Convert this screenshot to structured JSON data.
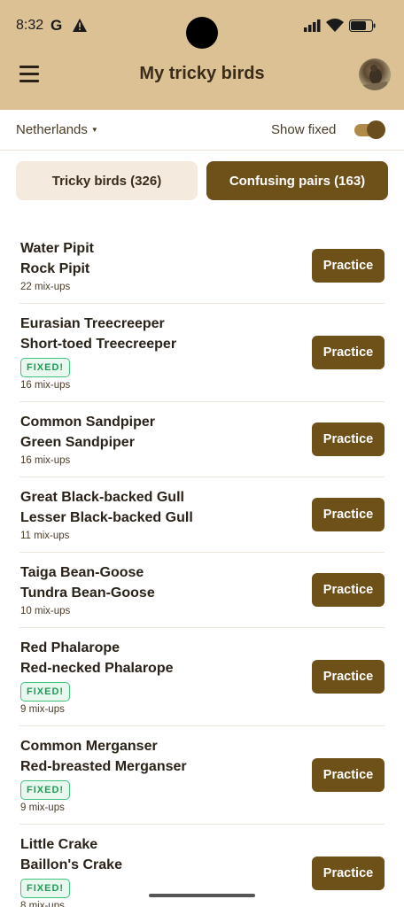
{
  "status_bar": {
    "time": "8:32",
    "g_label": "G"
  },
  "app_bar": {
    "title": "My tricky birds",
    "menu_icon": "hamburger-menu-icon",
    "avatar_icon": "profile-avatar"
  },
  "filters": {
    "country": "Netherlands",
    "show_fixed_label": "Show fixed",
    "show_fixed_on": true
  },
  "tabs": [
    {
      "label": "Tricky birds (326)",
      "active": false
    },
    {
      "label": "Confusing pairs (163)",
      "active": true
    }
  ],
  "colors": {
    "accent": "#6e5019",
    "header_bg": "#dcc194",
    "tab_inactive_bg": "#f4ebde",
    "fixed_green": "#1f9a55"
  },
  "pairs": [
    {
      "bird_a": "Water Pipit",
      "bird_b": "Rock Pipit",
      "fixed": false,
      "fixed_label": "",
      "mixups": "22 mix-ups",
      "button": "Practice"
    },
    {
      "bird_a": "Eurasian Treecreeper",
      "bird_b": "Short-toed Treecreeper",
      "fixed": true,
      "fixed_label": "FIXED!",
      "mixups": "16 mix-ups",
      "button": "Practice"
    },
    {
      "bird_a": "Common Sandpiper",
      "bird_b": "Green Sandpiper",
      "fixed": false,
      "fixed_label": "",
      "mixups": "16 mix-ups",
      "button": "Practice"
    },
    {
      "bird_a": "Great Black-backed Gull",
      "bird_b": "Lesser Black-backed Gull",
      "fixed": false,
      "fixed_label": "",
      "mixups": "11 mix-ups",
      "button": "Practice"
    },
    {
      "bird_a": "Taiga Bean-Goose",
      "bird_b": "Tundra Bean-Goose",
      "fixed": false,
      "fixed_label": "",
      "mixups": "10 mix-ups",
      "button": "Practice"
    },
    {
      "bird_a": "Red Phalarope",
      "bird_b": "Red-necked Phalarope",
      "fixed": true,
      "fixed_label": "FIXED!",
      "mixups": "9 mix-ups",
      "button": "Practice"
    },
    {
      "bird_a": "Common Merganser",
      "bird_b": "Red-breasted Merganser",
      "fixed": true,
      "fixed_label": "FIXED!",
      "mixups": "9 mix-ups",
      "button": "Practice"
    },
    {
      "bird_a": "Little Crake",
      "bird_b": "Baillon's Crake",
      "fixed": true,
      "fixed_label": "FIXED!",
      "mixups": "8 mix-ups",
      "button": "Practice"
    }
  ]
}
